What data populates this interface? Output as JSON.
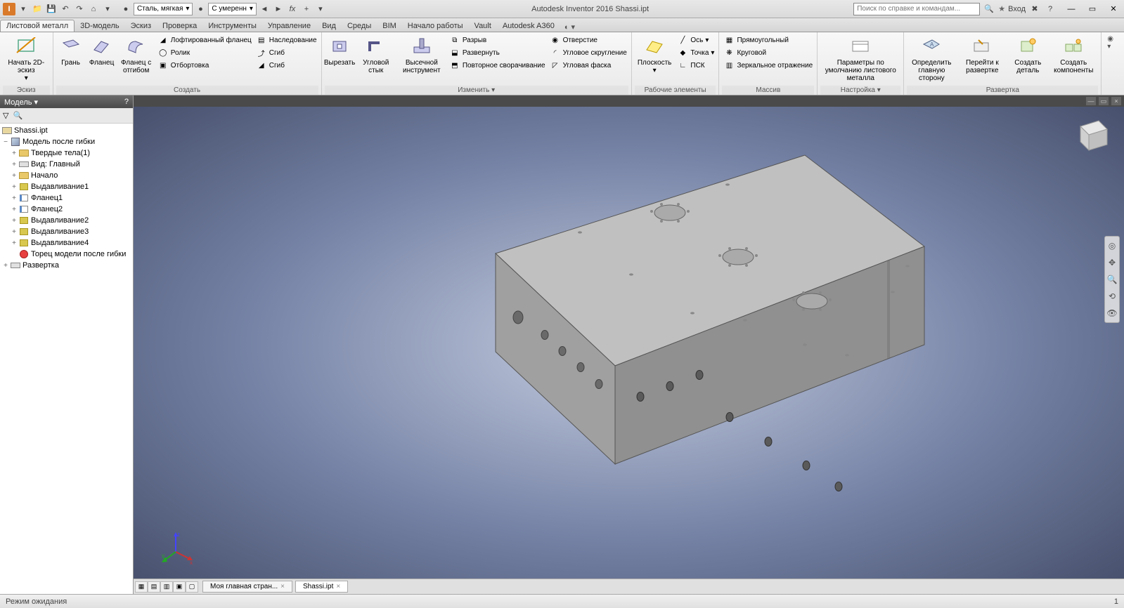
{
  "title": "Autodesk Inventor 2016   Shassi.ipt",
  "search_placeholder": "Поиск по справке и командам...",
  "signin": "Вход",
  "material_dropdown": "Сталь, мягкая",
  "appearance_dropdown": "С умеренн",
  "menu_tabs": [
    "Листовой металл",
    "3D-модель",
    "Эскиз",
    "Проверка",
    "Инструменты",
    "Управление",
    "Вид",
    "Среды",
    "BIM",
    "Начало работы",
    "Vault",
    "Autodesk A360"
  ],
  "ribbon": {
    "sketch": {
      "btn": "Начать 2D-эскиз",
      "label": "Эскиз"
    },
    "create": {
      "face": "Грань",
      "flange": "Фланец",
      "flange_hem": "Фланец с отгибом",
      "loft_flange": "Лофтированный фланец",
      "inherit": "Наследование",
      "roller": "Ролик",
      "bend": "Сгиб",
      "trim": "Отбортовка",
      "fold": "Сгиб",
      "label": "Создать"
    },
    "modify": {
      "cut": "Вырезать",
      "corner": "Угловой стык",
      "punch": "Высечной инструмент",
      "rip": "Разрыв",
      "unfold": "Развернуть",
      "refold": "Повторное сворачивание",
      "hole": "Отверстие",
      "round": "Угловое скругление",
      "chamfer": "Угловая фаска",
      "label": "Изменить"
    },
    "work": {
      "plane": "Плоскость",
      "axis": "Ось",
      "point": "Точка",
      "ucs": "ПСК",
      "label": "Рабочие элементы"
    },
    "pattern": {
      "rect": "Прямоугольный",
      "circ": "Круговой",
      "mirror": "Зеркальное отражение",
      "label": "Массив"
    },
    "setup": {
      "defaults": "Параметры по умолчанию листового металла",
      "label": "Настройка"
    },
    "flat": {
      "define": "Определить главную сторону",
      "goto": "Перейти к развертке",
      "part": "Создать деталь",
      "comp": "Создать компоненты",
      "label": "Развертка"
    }
  },
  "browser": {
    "title": "Модель",
    "root": "Shassi.ipt",
    "items": [
      {
        "label": "Модель после гибки",
        "icon": "cube",
        "expand": "−"
      },
      {
        "label": "Твердые тела(1)",
        "icon": "folder",
        "indent": 1,
        "expand": "+"
      },
      {
        "label": "Вид: Главный",
        "icon": "view",
        "indent": 1,
        "expand": "+"
      },
      {
        "label": "Начало",
        "icon": "folder",
        "indent": 1,
        "expand": "+"
      },
      {
        "label": "Выдавливание1",
        "icon": "feat",
        "indent": 1,
        "expand": "+"
      },
      {
        "label": "Фланец1",
        "icon": "flange",
        "indent": 1,
        "expand": "+"
      },
      {
        "label": "Фланец2",
        "icon": "flange",
        "indent": 1,
        "expand": "+"
      },
      {
        "label": "Выдавливание2",
        "icon": "feat",
        "indent": 1,
        "expand": "+"
      },
      {
        "label": "Выдавливание3",
        "icon": "feat",
        "indent": 1,
        "expand": "+"
      },
      {
        "label": "Выдавливание4",
        "icon": "feat",
        "indent": 1,
        "expand": "+"
      },
      {
        "label": "Торец модели после гибки",
        "icon": "stop",
        "indent": 1,
        "expand": ""
      },
      {
        "label": "Развертка",
        "icon": "flat",
        "indent": 0,
        "expand": "+"
      }
    ]
  },
  "bottom_tabs": {
    "home": "Моя главная стран...",
    "doc": "Shassi.ipt"
  },
  "status": {
    "left": "Режим ожидания",
    "right": "1"
  }
}
